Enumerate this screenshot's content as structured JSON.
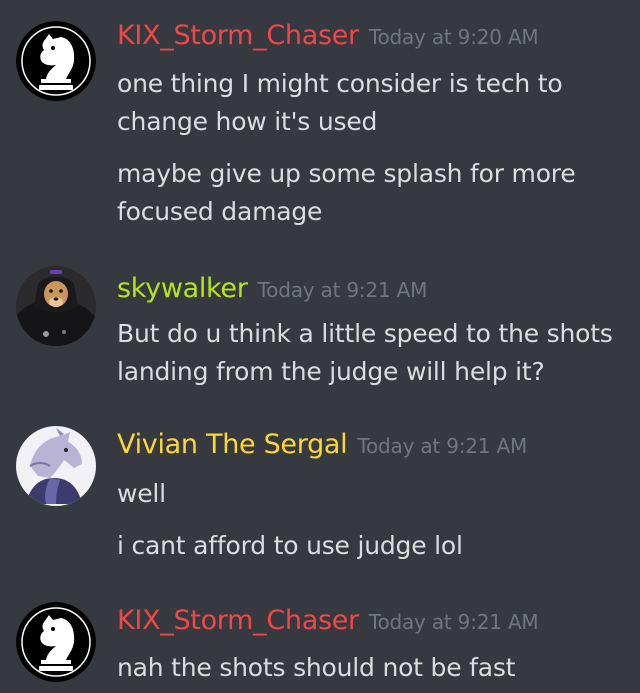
{
  "colors": {
    "background": "#36393f",
    "message_text": "#dcddde",
    "timestamp": "#72767d"
  },
  "groups": [
    {
      "author": "KIX_Storm_Chaser",
      "author_color": "#f04747",
      "avatar_icon": "chess-knight-icon",
      "timestamp": "Today at 9:20 AM",
      "messages": [
        "one thing I might consider is tech to change how it's used",
        "maybe give up some splash for more focused damage"
      ]
    },
    {
      "author": "skywalker",
      "author_color": "#b5e61d",
      "avatar_icon": "dog-hoodie-photo",
      "timestamp": "Today at 9:21 AM",
      "messages": [
        "But do u think a little speed to the shots landing from the judge will help it?"
      ]
    },
    {
      "author": "Vivian The Sergal",
      "author_color": "#fdd835",
      "avatar_icon": "sergal-sketch-avatar",
      "timestamp": "Today at 9:21 AM",
      "messages": [
        "well",
        "i cant afford to use judge lol"
      ]
    },
    {
      "author": "KIX_Storm_Chaser",
      "author_color": "#f04747",
      "avatar_icon": "chess-knight-icon",
      "timestamp": "Today at 9:21 AM",
      "messages": [
        "nah the shots should not be fast"
      ]
    }
  ]
}
